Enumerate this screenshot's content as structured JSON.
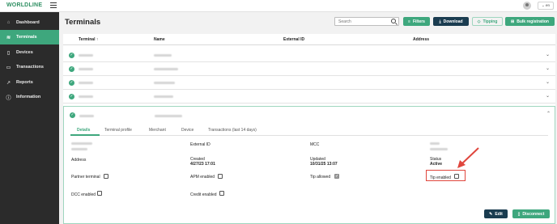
{
  "app": {
    "logo_text": "WORLDLINE"
  },
  "header": {
    "language": "en"
  },
  "sidebar": {
    "items": [
      {
        "label": "Dashboard",
        "icon": "home-icon"
      },
      {
        "label": "Terminals",
        "icon": "wifi-icon"
      },
      {
        "label": "Devices",
        "icon": "device-icon"
      },
      {
        "label": "Transactions",
        "icon": "card-icon"
      },
      {
        "label": "Reports",
        "icon": "chart-icon"
      },
      {
        "label": "Information",
        "icon": "info-icon"
      }
    ],
    "active": "Terminals"
  },
  "page": {
    "title": "Terminals"
  },
  "toolbar": {
    "search_placeholder": "Search",
    "filters_label": "Filters",
    "download_label": "Download",
    "tipping_label": "Tipping",
    "bulk_label": "Bulk registration"
  },
  "table": {
    "columns": [
      "Terminal ↑",
      "Name",
      "External ID",
      "Address"
    ]
  },
  "details": {
    "tabs": [
      "Details",
      "Terminal profile",
      "Merchant",
      "Device",
      "Transactions (last 14 days)"
    ],
    "active_tab": "Details",
    "labels": {
      "external_id": "External ID",
      "mcc": "MCC",
      "address": "Address",
      "created": "Created",
      "updated": "Updated",
      "status": "Status",
      "partner_terminal": "Partner terminal",
      "apm_enabled": "APM enabled",
      "tip_allowed": "Tip allowed",
      "tip_enabled": "Tip enabled",
      "dcc_enabled": "DCC enabled",
      "credit_enabled": "Credit enabled"
    },
    "values": {
      "created": "4/27/23 17:01",
      "updated": "10/31/25 13:07",
      "status": "Active"
    },
    "checkboxes": {
      "partner_terminal": false,
      "apm_enabled": false,
      "tip_allowed": true,
      "tip_enabled": false,
      "dcc_enabled": false,
      "credit_enabled": false
    },
    "edit_label": "Edit",
    "disconnect_label": "Disconnect"
  },
  "colors": {
    "accent": "#3ea77d",
    "sidebar": "#2b2b2b",
    "primary_dark": "#1a3c50",
    "highlight": "#e0463d"
  }
}
